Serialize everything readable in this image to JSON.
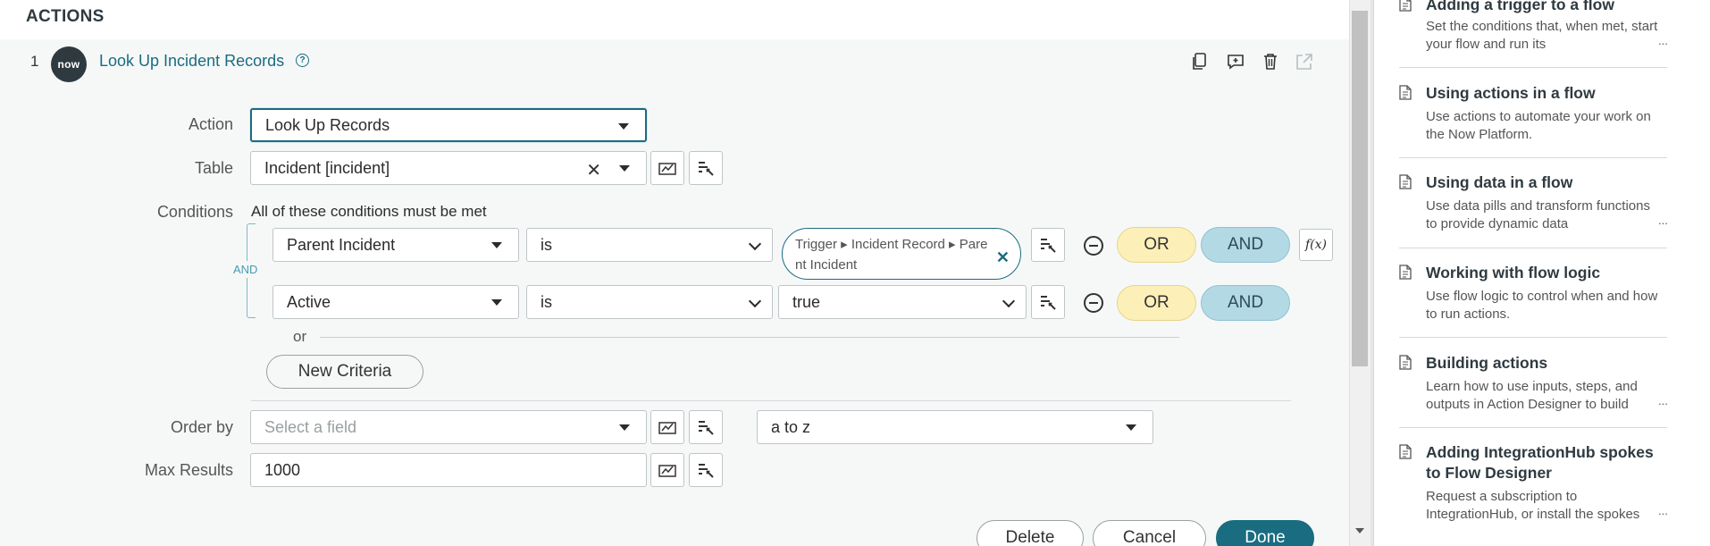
{
  "header": {
    "title": "ACTIONS"
  },
  "action": {
    "step_number": "1",
    "badge": "now",
    "title": "Look Up Incident Records",
    "help_glyph": "?",
    "header_icons": [
      "copy-icon",
      "add-comment-icon",
      "trash-icon",
      "open-external-icon"
    ]
  },
  "form": {
    "action_label": "Action",
    "action_value": "Look Up Records",
    "table_label": "Table",
    "table_value": "Incident [incident]",
    "conditions_label": "Conditions",
    "conditions_header": "All of these conditions must be met",
    "and_label": "AND",
    "conditions": [
      {
        "field": "Parent Incident",
        "operator": "is",
        "value_pill_line1": "Trigger ▸ Incident Record ▸ Pare",
        "value_pill_line2": "nt Incident"
      },
      {
        "field": "Active",
        "operator": "is",
        "value": "true"
      }
    ],
    "or_button": "OR",
    "and_button": "AND",
    "fx_button": "f(x)",
    "or_separator": "or",
    "new_criteria": "New Criteria",
    "order_by_label": "Order by",
    "order_by_placeholder": "Select a field",
    "sort_order": "a to z",
    "max_results_label": "Max Results",
    "max_results_value": "1000"
  },
  "footer": {
    "delete": "Delete",
    "cancel": "Cancel",
    "done": "Done"
  },
  "sidebar": {
    "items": [
      {
        "title": "Adding a trigger to a flow",
        "desc": "Set the conditions that, when met, start your flow and run its",
        "ellipsis": "..."
      },
      {
        "title": "Using actions in a flow",
        "desc": "Use actions to automate your work on the Now Platform.",
        "ellipsis": ""
      },
      {
        "title": "Using data in a flow",
        "desc": "Use data pills and transform functions to provide dynamic data",
        "ellipsis": "..."
      },
      {
        "title": "Working with flow logic",
        "desc": "Use flow logic to control when and how to run actions.",
        "ellipsis": ""
      },
      {
        "title": "Building actions",
        "desc": "Learn how to use inputs, steps, and outputs in Action Designer to build",
        "ellipsis": "..."
      },
      {
        "title": "Adding IntegrationHub spokes to Flow Designer",
        "desc": "Request a subscription to IntegrationHub, or install the spokes",
        "ellipsis": "..."
      }
    ]
  },
  "colors": {
    "accent": "#1a6c80",
    "or_fill": "#fcf0b8",
    "and_fill": "#b3d9e4",
    "panel_bg": "#f6f8f8"
  }
}
